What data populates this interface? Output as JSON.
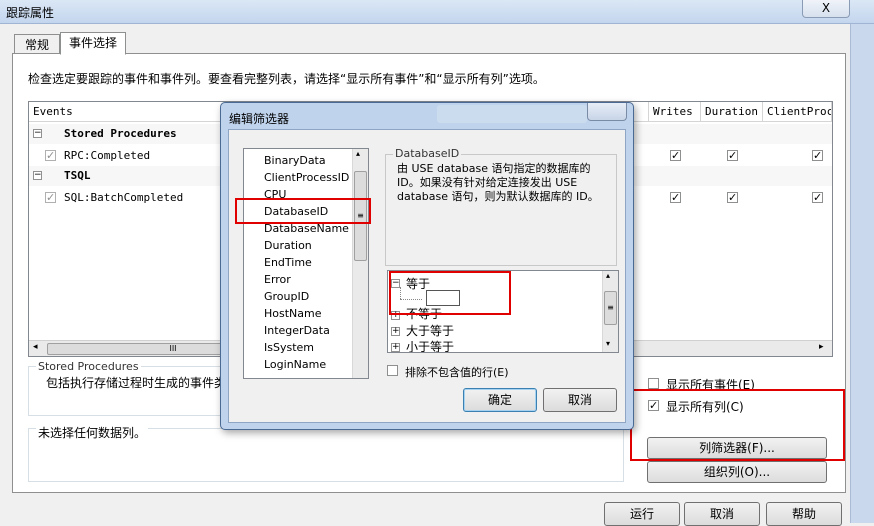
{
  "window": {
    "title": "跟踪属性",
    "close_glyph": "X"
  },
  "tabs": [
    {
      "label": "常规"
    },
    {
      "label": "事件选择"
    }
  ],
  "description": "检查选定要跟踪的事件和事件列。要查看完整列表，请选择“显示所有事件”和“显示所有列”选项。",
  "grid": {
    "columns": {
      "events": "Events",
      "writes": "Writes",
      "duration": "Duration",
      "clientproc": "ClientProc"
    },
    "categories": [
      {
        "name": "Stored Procedures"
      },
      {
        "name": "TSQL"
      }
    ],
    "events": [
      {
        "name": "RPC:Completed"
      },
      {
        "name": "SQL:BatchCompleted"
      }
    ],
    "check_glyph": "✓",
    "scroll_grip": "III"
  },
  "selected_event": {
    "title": "Stored Procedures",
    "text": "包括执行存储过程时生成的事件类"
  },
  "no_column_text": "未选择任何数据列。",
  "options": {
    "show_all_events": {
      "label": "显示所有事件(E)",
      "checked": false
    },
    "show_all_columns": {
      "label": "显示所有列(C)",
      "checked": true
    }
  },
  "buttons": {
    "column_filter": "列筛选器(F)...",
    "organize_columns": "组织列(O)...",
    "run": "运行",
    "cancel": "取消",
    "help": "帮助"
  },
  "filter_dialog": {
    "title": "编辑筛选器",
    "columns": [
      "BinaryData",
      "ClientProcessID",
      "CPU",
      "DatabaseID",
      "DatabaseName",
      "Duration",
      "EndTime",
      "Error",
      "GroupID",
      "HostName",
      "IntegerData",
      "IsSystem",
      "LoginName"
    ],
    "selected_column": "DatabaseID",
    "info_group_title": "DatabaseID",
    "info_text": "由 USE database 语句指定的数据库的 ID。如果没有针对给定连接发出 USE database 语句，则为默认数据库的 ID。",
    "tree": {
      "equals": "等于",
      "equals_value": "",
      "not_equals": "不等于",
      "greater_than": "大于等于",
      "less_than": "小于等于",
      "minus_glyph": "−",
      "plus_glyph": "+"
    },
    "exclude_nulls": {
      "label": "排除不包含值的行(E)",
      "checked": false
    },
    "ok": "确定",
    "cancel": "取消"
  }
}
